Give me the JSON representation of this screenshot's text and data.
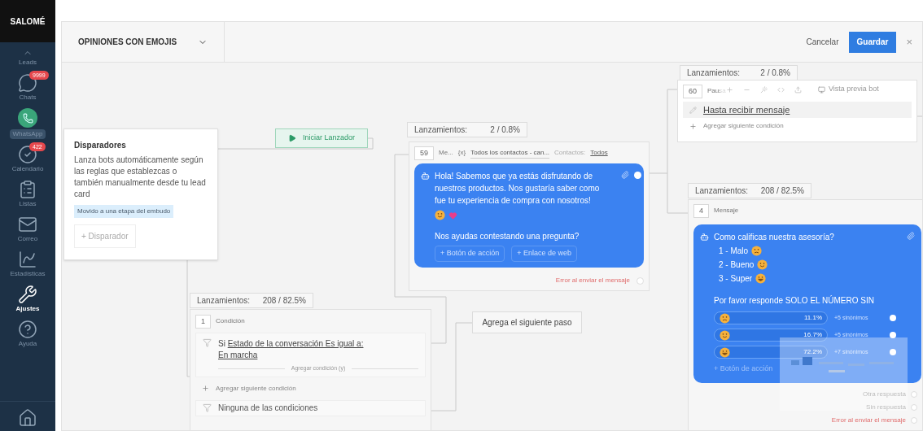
{
  "sidebar": {
    "logo": "SALOMÉ",
    "items": [
      {
        "kind": "leads",
        "label": "Leads",
        "selected": false
      },
      {
        "kind": "chats",
        "label": "Chats",
        "badge": "9999",
        "selected": false
      },
      {
        "kind": "whatsapp",
        "label": "WhatsApp",
        "selected": false
      },
      {
        "kind": "calendar",
        "label": "Calendario",
        "badge": "422",
        "selected": false
      },
      {
        "kind": "lists",
        "label": "Listas",
        "selected": false
      },
      {
        "kind": "mail",
        "label": "Correo",
        "selected": false
      },
      {
        "kind": "stats",
        "label": "Estadísticas",
        "selected": false
      },
      {
        "kind": "settings",
        "label": "Ajustes",
        "selected": true
      },
      {
        "kind": "help",
        "label": "Ayuda",
        "selected": false
      },
      {
        "kind": "home"
      }
    ]
  },
  "header": {
    "title": "OPINIONES CON EMOJIS",
    "cancel": "Cancelar",
    "save": "Guardar",
    "close": "×"
  },
  "canvas": {
    "triggers": {
      "title": "Disparadores",
      "description": "Lanza bots automáticamente según las reglas que establezcas o también manualmente desde tu lead card",
      "tag": "Movido a una etapa del embudo",
      "add_button": "+ Disparador"
    },
    "start_button": "Iniciar Lanzador",
    "message_node": {
      "launches_label": "Lanzamientos:",
      "launches": "2 / 0.8%",
      "number": "59",
      "type": "Me...",
      "variable": "{x}",
      "audience": "Todos los contactos - can...",
      "contacts_label": "Contactos:",
      "contacts_value": "Todos",
      "text": "Hola! Sabemos que ya estás disfrutando de nuestros productos. Nos gustaría saber como fue tu experiencia de compra con nosotros!",
      "question": "Nos ayudas contestando una pregunta?",
      "buttons": [
        "+ Botón de acción",
        "+ Enlace de web"
      ],
      "error": "Error al enviar el mensaje"
    },
    "pause_node": {
      "launches_label": "Lanzamientos:",
      "launches": "2 / 0.8%",
      "number": "60",
      "type": "Pausa",
      "preview": "Vista previa bot",
      "condition": "Hasta recibir mensaje",
      "add": "Agregar siguiente condición"
    },
    "rating_node": {
      "launches_label": "Lanzamientos:",
      "launches": "208 / 82.5%",
      "number": "4",
      "type": "Mensaje",
      "question": "Como calificas nuestra asesoría?",
      "options": [
        {
          "text": "1 - Malo",
          "kind": "angry"
        },
        {
          "text": "2 - Bueno",
          "kind": "happy"
        },
        {
          "text": "3 - Super",
          "kind": "love"
        }
      ],
      "prompt": "Por favor responde SOLO EL NÚMERO SIN",
      "answers": [
        {
          "kind": "angry",
          "share": "11.1%",
          "synonyms": "+5 sinónimos"
        },
        {
          "kind": "happy",
          "share": "16.7%",
          "synonyms": "+5 sinónimos"
        },
        {
          "kind": "love",
          "share": "72.2%",
          "synonyms": "+7 sinónimos"
        }
      ],
      "action": "+ Botón de acción",
      "outcomes": [
        "Otra respuesta",
        "Sin respuesta"
      ],
      "error": "Error al enviar el mensaje"
    },
    "condition_node": {
      "launches_label": "Lanzamientos:",
      "launches": "208 / 82.5%",
      "number": "1",
      "type": "Condición",
      "prefix": "Si",
      "condition": "Estado de la conversación Es igual a: En marcha",
      "and": "Agregar condición (y)",
      "add": "Agregar siguiente condición",
      "none": "Ninguna de las condiciones"
    },
    "next_step": "Agrega el siguiente paso"
  }
}
